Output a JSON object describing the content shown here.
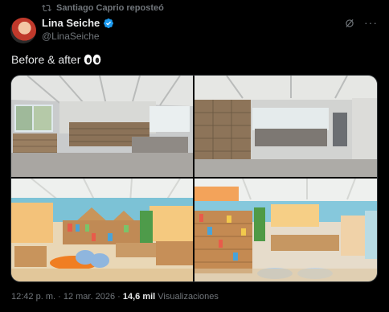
{
  "repost": {
    "text": "Santiago Caprio reposteó"
  },
  "author": {
    "name": "Lina Seiche",
    "handle": "@LinaSeiche"
  },
  "post": {
    "text": "Before & after"
  },
  "media": {
    "images": [
      {
        "name": "classroom-before-1"
      },
      {
        "name": "classroom-before-2"
      },
      {
        "name": "classroom-after-1"
      },
      {
        "name": "classroom-after-2"
      }
    ]
  },
  "footer": {
    "time": "12:42 p. m.",
    "separator": "·",
    "date": "12 mar. 2026",
    "views_count": "14,6 mil",
    "views_label": "Visualizaciones"
  },
  "colors": {
    "background": "#000000",
    "text": "#e7e9ea",
    "muted": "#71767b",
    "verified": "#1d9bf0"
  }
}
